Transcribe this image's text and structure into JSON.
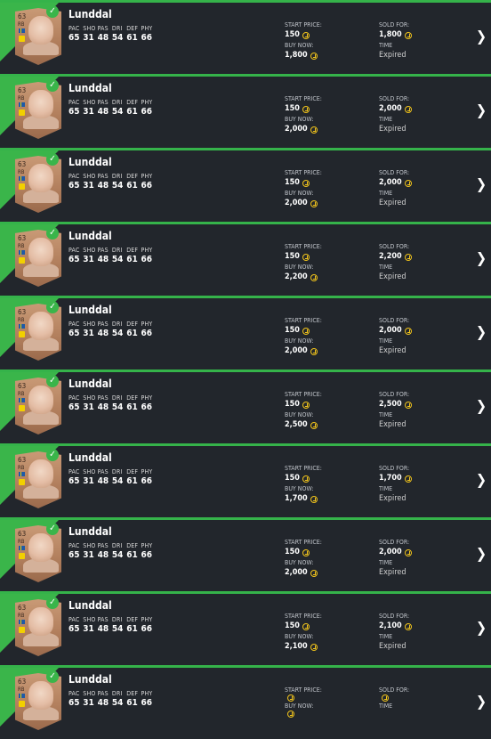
{
  "labels": {
    "start_price": "START PRICE:",
    "buy_now": "BUY NOW:",
    "sold_for": "SOLD FOR:",
    "time": "TIME",
    "stat_names": [
      "PAC",
      "SHO",
      "PAS",
      "DRI",
      "DEF",
      "PHY"
    ]
  },
  "colors": {
    "accent": "#3ab54a",
    "row_bg": "#22262c",
    "coin": "#f3c51b"
  },
  "icons": {
    "check": "check-icon",
    "coin": "coin-icon",
    "chevron": "chevron-right-icon"
  },
  "items": [
    {
      "name": "Lunddal",
      "rating": "63",
      "position": "RB",
      "stats": [
        "65",
        "31",
        "48",
        "54",
        "61",
        "66"
      ],
      "start_price": "150",
      "buy_now": "1,800",
      "sold_for": "1,800",
      "time": "Expired"
    },
    {
      "name": "Lunddal",
      "rating": "63",
      "position": "RB",
      "stats": [
        "65",
        "31",
        "48",
        "54",
        "61",
        "66"
      ],
      "start_price": "150",
      "buy_now": "2,000",
      "sold_for": "2,000",
      "time": "Expired"
    },
    {
      "name": "Lunddal",
      "rating": "63",
      "position": "RB",
      "stats": [
        "65",
        "31",
        "48",
        "54",
        "61",
        "66"
      ],
      "start_price": "150",
      "buy_now": "2,000",
      "sold_for": "2,000",
      "time": "Expired"
    },
    {
      "name": "Lunddal",
      "rating": "63",
      "position": "RB",
      "stats": [
        "65",
        "31",
        "48",
        "54",
        "61",
        "66"
      ],
      "start_price": "150",
      "buy_now": "2,200",
      "sold_for": "2,200",
      "time": "Expired"
    },
    {
      "name": "Lunddal",
      "rating": "63",
      "position": "RB",
      "stats": [
        "65",
        "31",
        "48",
        "54",
        "61",
        "66"
      ],
      "start_price": "150",
      "buy_now": "2,000",
      "sold_for": "2,000",
      "time": "Expired"
    },
    {
      "name": "Lunddal",
      "rating": "63",
      "position": "RB",
      "stats": [
        "65",
        "31",
        "48",
        "54",
        "61",
        "66"
      ],
      "start_price": "150",
      "buy_now": "2,500",
      "sold_for": "2,500",
      "time": "Expired"
    },
    {
      "name": "Lunddal",
      "rating": "63",
      "position": "RB",
      "stats": [
        "65",
        "31",
        "48",
        "54",
        "61",
        "66"
      ],
      "start_price": "150",
      "buy_now": "1,700",
      "sold_for": "1,700",
      "time": "Expired"
    },
    {
      "name": "Lunddal",
      "rating": "63",
      "position": "RB",
      "stats": [
        "65",
        "31",
        "48",
        "54",
        "61",
        "66"
      ],
      "start_price": "150",
      "buy_now": "2,000",
      "sold_for": "2,000",
      "time": "Expired"
    },
    {
      "name": "Lunddal",
      "rating": "63",
      "position": "RB",
      "stats": [
        "65",
        "31",
        "48",
        "54",
        "61",
        "66"
      ],
      "start_price": "150",
      "buy_now": "2,100",
      "sold_for": "2,100",
      "time": "Expired"
    },
    {
      "name": "Lunddal",
      "rating": "63",
      "position": "RB",
      "stats": [
        "65",
        "31",
        "48",
        "54",
        "61",
        "66"
      ],
      "start_price": "",
      "buy_now": "",
      "sold_for": "",
      "time": ""
    }
  ]
}
